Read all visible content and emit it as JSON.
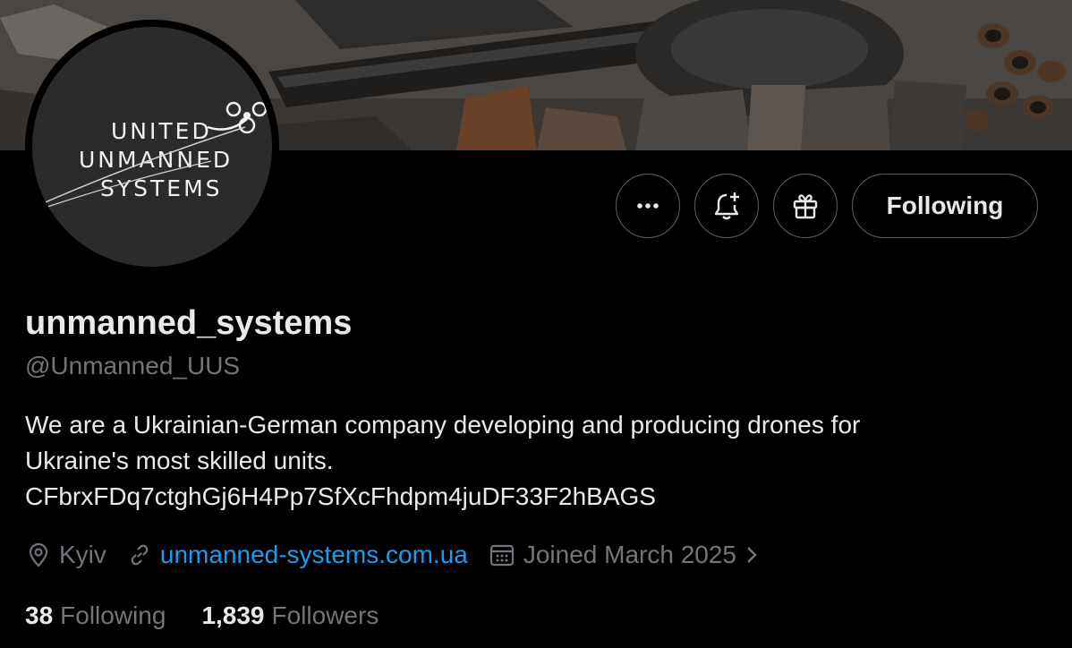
{
  "profile": {
    "display_name": "unmanned_systems",
    "handle": "@Unmanned_UUS",
    "bio_lines": [
      "We are a Ukrainian-German company developing and producing drones for",
      "Ukraine's most skilled units.",
      "CFbrxFDq7ctghGj6H4Pp7SfXcFhdpm4juDF33F2hBAGS"
    ],
    "location": "Kyiv",
    "website": "unmanned-systems.com.ua",
    "joined": "Joined March 2025",
    "following_count": "38",
    "following_label": "Following",
    "followers_count": "1,839",
    "followers_label": "Followers"
  },
  "avatar": {
    "logo_lines": [
      "UNITED",
      "UNMANNED",
      "SYSTEMS"
    ]
  },
  "actions": {
    "more_icon": "more-icon",
    "notify_icon": "bell-plus-icon",
    "subscribe_icon": "gift-icon",
    "follow_label": "Following"
  },
  "colors": {
    "background": "#000000",
    "text_primary": "#e7e9ea",
    "text_secondary": "#71767b",
    "link": "#1d9bf0",
    "border": "#536471"
  }
}
